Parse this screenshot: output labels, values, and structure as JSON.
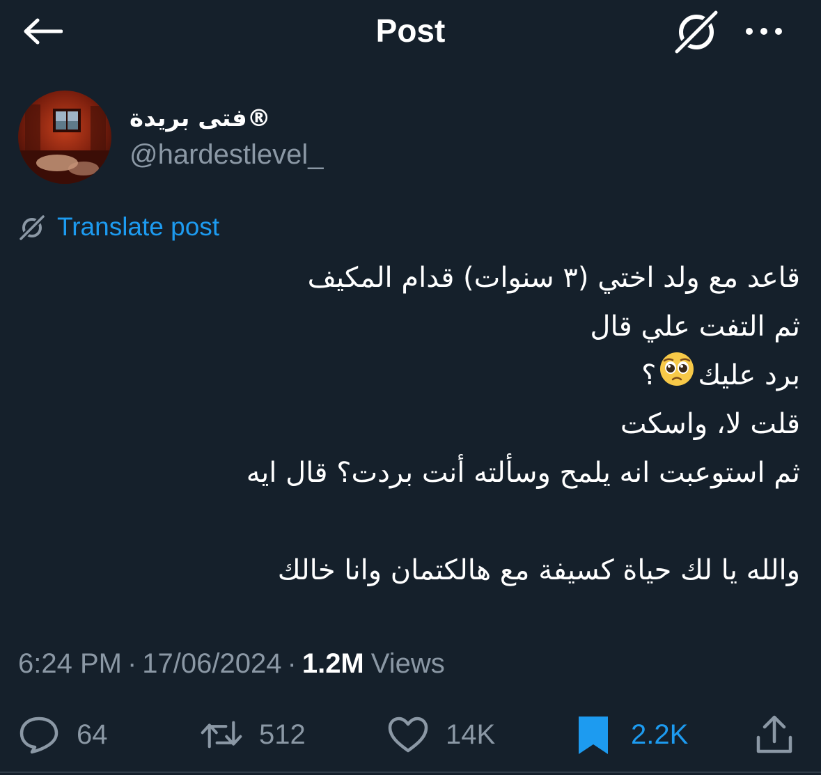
{
  "header": {
    "title": "Post",
    "back_icon": "arrow-left-icon",
    "grok_icon": "grok-icon",
    "more_icon": "more-dots-icon"
  },
  "author": {
    "display_name": "فتى بريدة®",
    "handle": "@hardestlevel_"
  },
  "translate": {
    "label": "Translate post",
    "icon": "grok-translate-icon"
  },
  "post": {
    "lines": [
      "قاعد مع ولد اختي (٣ سنوات) قدام المكيف",
      "ثم التفت علي قال",
      "برد عليك",
      "قلت لا، واسكت",
      "ثم استوعبت انه يلمح وسألته أنت بردت؟ قال ايه",
      "",
      "والله يا لك حياة كسيفة مع هالكتمان وانا خالك"
    ],
    "question_mark": "؟",
    "emoji": "pleading-face-emoji"
  },
  "meta": {
    "time": "6:24 PM",
    "separator": "·",
    "date": "17/06/2024",
    "views_count": "1.2M",
    "views_label": "Views"
  },
  "actions": {
    "reply_count": "64",
    "retweet_count": "512",
    "like_count": "14K",
    "bookmark_count": "2.2K"
  },
  "colors": {
    "background": "#15202b",
    "accent": "#1d9bf0",
    "secondary_text": "#8b98a5"
  }
}
